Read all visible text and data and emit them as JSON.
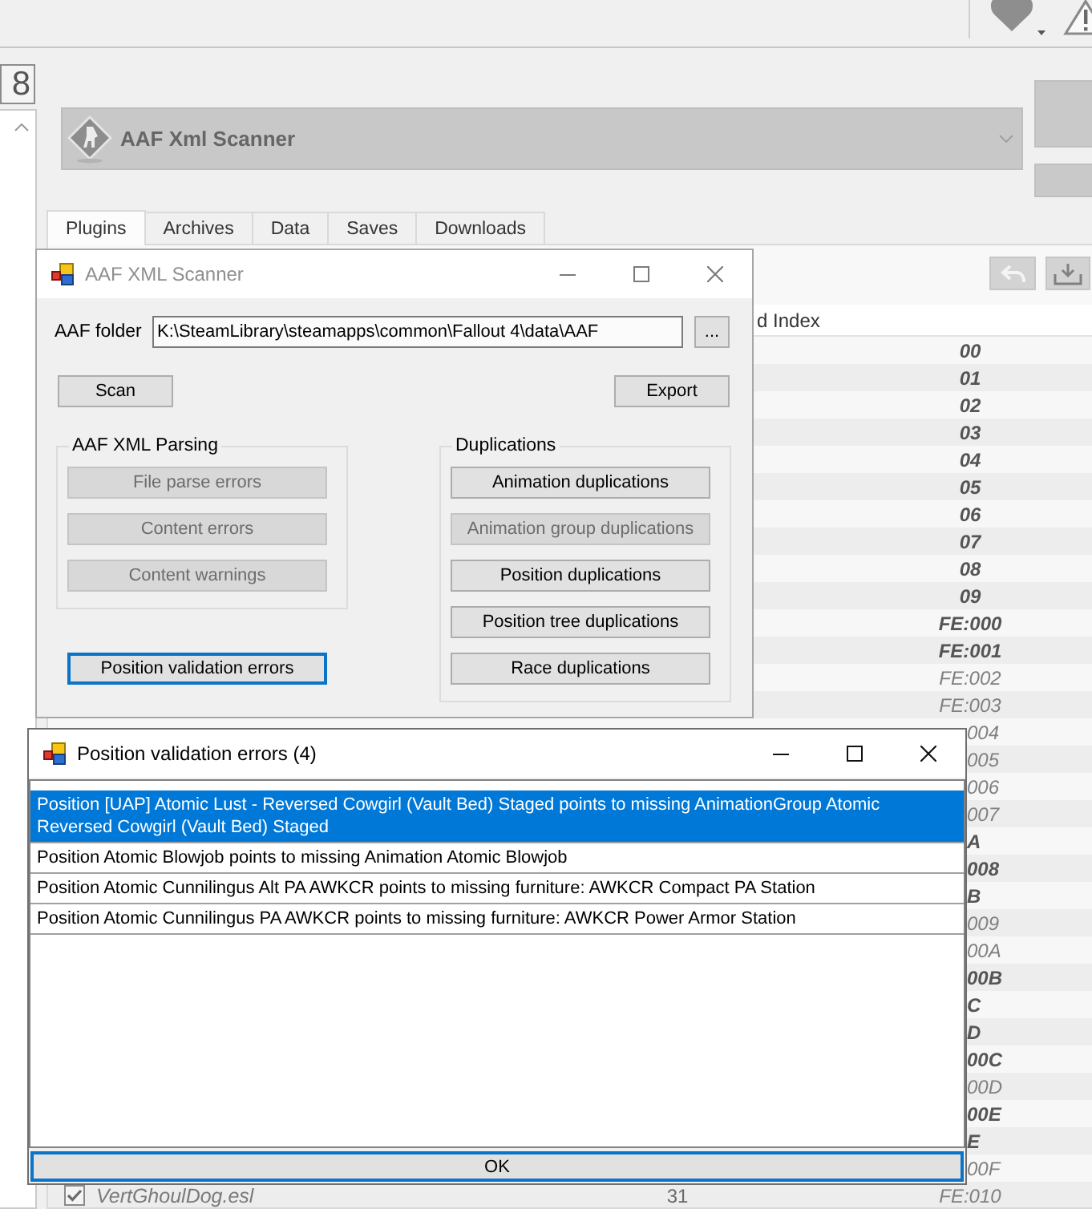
{
  "counter": "8",
  "profile": {
    "name": "AAF Xml Scanner"
  },
  "tabs": [
    {
      "label": "Plugins",
      "selected": true
    },
    {
      "label": "Archives",
      "selected": false
    },
    {
      "label": "Data",
      "selected": false
    },
    {
      "label": "Saves",
      "selected": false
    },
    {
      "label": "Downloads",
      "selected": false
    }
  ],
  "plugin_list": {
    "column_header": "d Index",
    "rows": [
      {
        "index": "00",
        "bold": true
      },
      {
        "index": "01",
        "bold": true
      },
      {
        "index": "02",
        "bold": true
      },
      {
        "index": "03",
        "bold": true
      },
      {
        "index": "04",
        "bold": true
      },
      {
        "index": "05",
        "bold": true
      },
      {
        "index": "06",
        "bold": true
      },
      {
        "index": "07",
        "bold": true
      },
      {
        "index": "08",
        "bold": true
      },
      {
        "index": "09",
        "bold": true
      },
      {
        "index": "FE:000",
        "bold": true
      },
      {
        "index": "FE:001",
        "bold": true
      },
      {
        "index": "FE:002",
        "bold": false
      },
      {
        "index": "FE:003",
        "bold": false
      },
      {
        "index": "004",
        "bold": false
      },
      {
        "index": "005",
        "bold": false
      },
      {
        "index": "006",
        "bold": false
      },
      {
        "index": "007",
        "bold": false
      },
      {
        "index": "A",
        "bold": true
      },
      {
        "index": "008",
        "bold": true
      },
      {
        "index": "B",
        "bold": true
      },
      {
        "index": "009",
        "bold": false
      },
      {
        "index": "00A",
        "bold": false
      },
      {
        "index": "00B",
        "bold": true
      },
      {
        "index": "C",
        "bold": true
      },
      {
        "index": "D",
        "bold": true
      },
      {
        "index": "00C",
        "bold": true
      },
      {
        "index": "00D",
        "bold": false
      },
      {
        "index": "00E",
        "bold": true
      },
      {
        "index": "E",
        "bold": true
      },
      {
        "index": "00F",
        "bold": false
      },
      {
        "name": "VertGhoulDog.esl",
        "checked": true,
        "priority": "31",
        "index": "FE:010",
        "bold": false
      }
    ]
  },
  "scanner_window": {
    "title": "AAF XML Scanner",
    "active": false,
    "folder_label": "AAF folder",
    "folder_value": "K:\\SteamLibrary\\steamapps\\common\\Fallout 4\\data\\AAF",
    "browse_label": "...",
    "actions": [
      {
        "label": "Scan",
        "focused": false
      },
      {
        "label": "Export",
        "focused": false
      }
    ],
    "groups": [
      {
        "title": "AAF XML Parsing",
        "buttons": [
          {
            "label": "File parse errors",
            "disabled": true
          },
          {
            "label": "Content errors",
            "disabled": true
          },
          {
            "label": "Content warnings",
            "disabled": true
          }
        ]
      },
      {
        "title": "Duplications",
        "buttons": [
          {
            "label": "Animation duplications",
            "disabled": false
          },
          {
            "label": "Animation group duplications",
            "disabled": true
          },
          {
            "label": "Position duplications",
            "disabled": false
          },
          {
            "label": "Position tree duplications",
            "disabled": false
          },
          {
            "label": "Race duplications",
            "disabled": false
          }
        ]
      }
    ],
    "validation_button": {
      "label": "Position validation errors",
      "focused": true
    }
  },
  "errors_window": {
    "title": "Position validation errors (4)",
    "active": true,
    "items": [
      {
        "text": "Position [UAP] Atomic Lust - Reversed Cowgirl (Vault Bed) Staged points to missing AnimationGroup Atomic Reversed Cowgirl (Vault Bed) Staged",
        "selected": true
      },
      {
        "text": "Position Atomic Blowjob points to missing Animation Atomic Blowjob",
        "selected": false
      },
      {
        "text": "Position Atomic Cunnilingus Alt PA AWKCR points to missing furniture: AWKCR Compact PA Station",
        "selected": false
      },
      {
        "text": "Position Atomic Cunnilingus PA AWKCR points to missing furniture: AWKCR Power Armor Station",
        "selected": false
      }
    ],
    "ok_button": {
      "label": "OK",
      "focused": true
    }
  }
}
